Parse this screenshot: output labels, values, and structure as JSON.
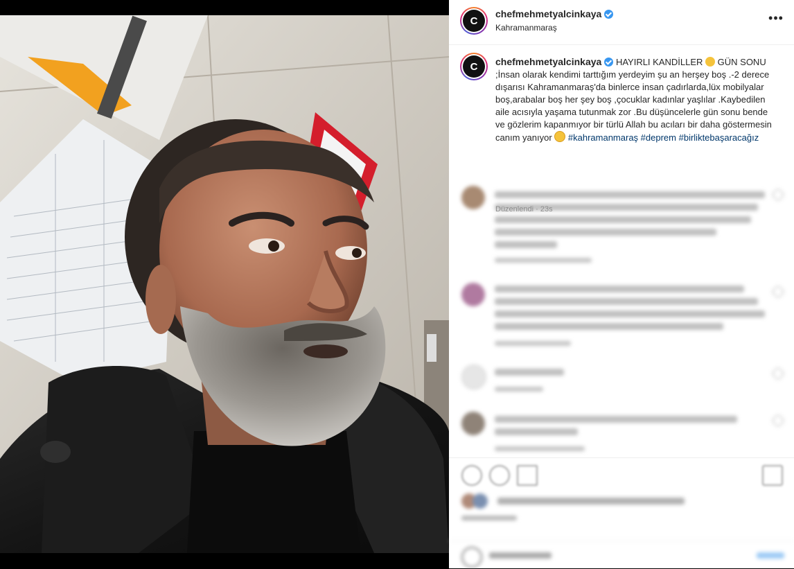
{
  "post": {
    "username": "chefmehmetyalcinkaya",
    "location": "Kahramanmaraş",
    "more_icon": "more-horizontal-icon",
    "avatar_letter": "C",
    "caption_parts": {
      "p1": "HAYIRLI KANDİLLER ",
      "p2": " GÜN SONU ;İnsan olarak kendimi tarttığım yerdeyim şu an herşey boş .-2 derece dışarısı Kahramanmaraş'da binlerce insan çadırlarda,lüx mobilyalar boş,arabalar boş her şey boş ,çocuklar kadınlar yaşlılar .Kaybedilen aile acısıyla yaşama tutunmak zor .Bu düşüncelerle gün sonu bende ve gözlerim kapanmıyor bir türlü Allah bu acıları bir daha göstermesin canım yanıyor ",
      "tag1": "#kahramanmaraş",
      "tag2": "#deprem",
      "tag3": "#birliktebaşaracağız"
    },
    "edited_label": "Düzenlendi",
    "edited_time": "23s"
  },
  "colors": {
    "verified": "#3897f0",
    "hashtag": "#00376b",
    "meta_gray": "#8e8e8e"
  }
}
